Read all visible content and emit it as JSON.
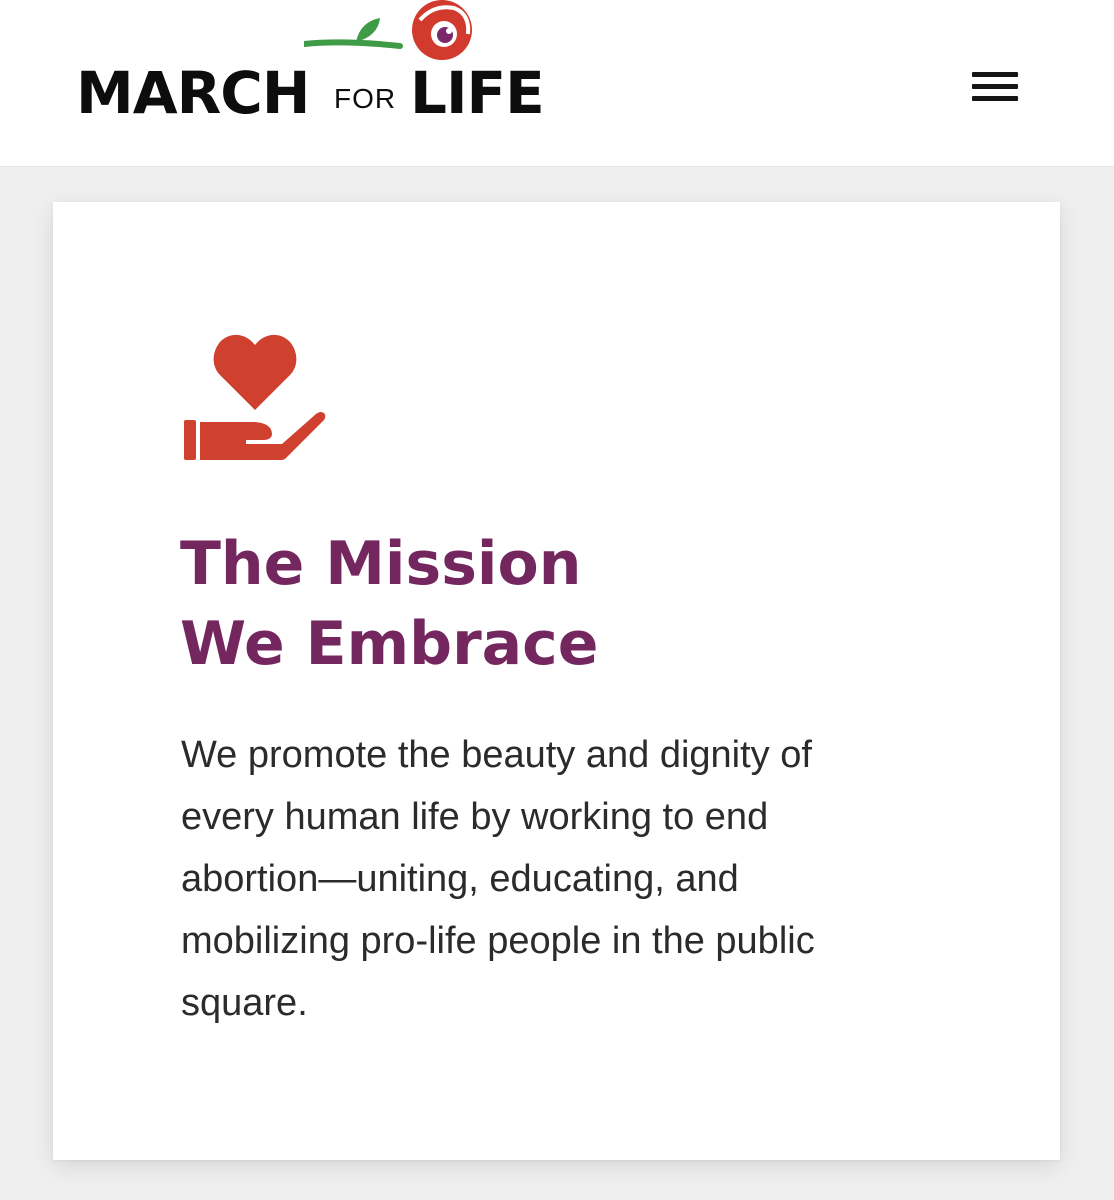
{
  "header": {
    "logo": {
      "word_march": "MARCH",
      "word_for": "FOR",
      "word_life": "LIFE"
    },
    "menu_icon": "hamburger-menu-icon"
  },
  "mission": {
    "icon": "heart-in-hand-icon",
    "title_line1": "The Mission",
    "title_line2": "We Embrace",
    "body": "We promote the beauty and dignity of every human life by working to end abortion—uniting, educating, and mobilizing pro-life people in the public square."
  },
  "colors": {
    "title": "#74265f",
    "icon": "#d0402f",
    "rose": "#d23a2e",
    "stem": "#3f9b45",
    "background": "#efefef"
  }
}
